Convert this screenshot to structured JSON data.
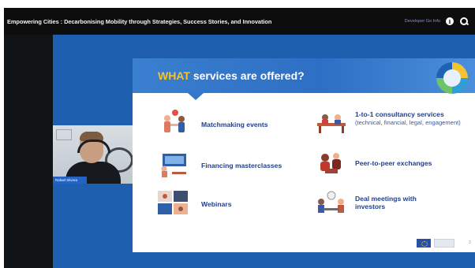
{
  "window": {
    "title": "Empowering Cities : Decarbonising Mobility through Strategies, Success Stories, and Innovation",
    "more_info_label": "Developer Go Info",
    "info_icon": "info-icon",
    "search_icon": "search-icon"
  },
  "slide": {
    "title_accent": "WHAT",
    "title_rest": " services are offered?",
    "services": [
      {
        "label": "Matchmaking events",
        "sub": "",
        "icon": "matchmaking-icon"
      },
      {
        "label": "1-to-1 consultancy services",
        "sub": "(technical, financial, legal, engagement)",
        "icon": "consultancy-icon"
      },
      {
        "label": "Financing masterclasses",
        "sub": "",
        "icon": "masterclass-icon"
      },
      {
        "label": "Peer-to-peer exchanges",
        "sub": "",
        "icon": "peer-exchange-icon"
      },
      {
        "label": "Webinars",
        "sub": "",
        "icon": "webinar-icon"
      },
      {
        "label": "Deal meetings with investors",
        "sub": "",
        "icon": "deal-meeting-icon"
      }
    ],
    "page_number": "3"
  },
  "participant": {
    "name": "Rafael Silvera"
  },
  "colors": {
    "topbar": "#0d0d0d",
    "panel_blue": "#1f5fb0",
    "slide_header": "#2d6fc4",
    "accent_yellow": "#f7c52b",
    "service_text": "#1f3f8f"
  }
}
